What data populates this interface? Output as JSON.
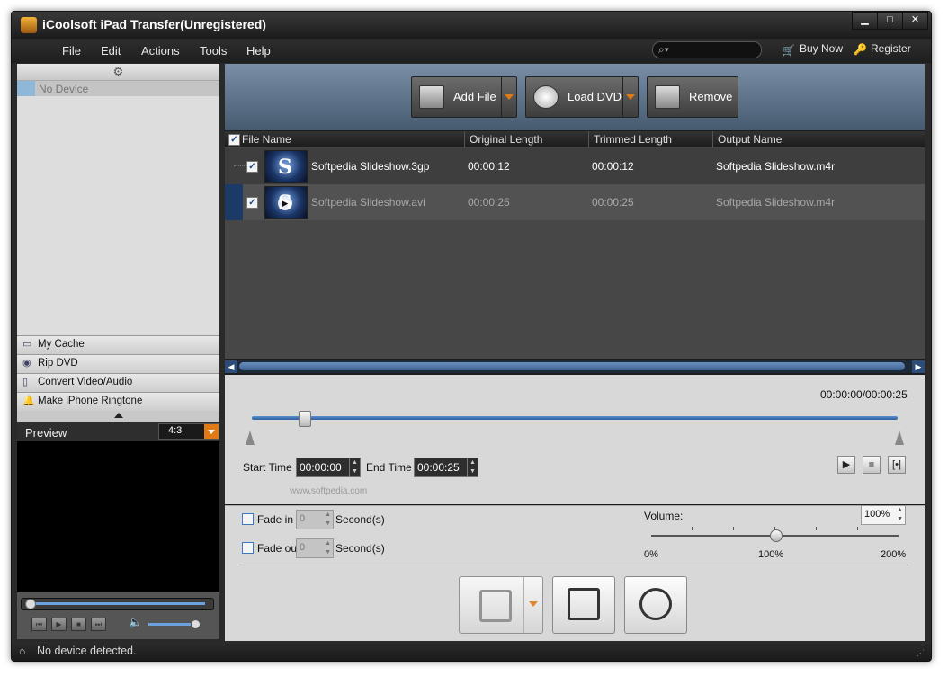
{
  "window": {
    "title": "iCoolsoft iPad Transfer(Unregistered)",
    "min": "▁",
    "max": "□",
    "close": "✕"
  },
  "menu": {
    "items": [
      "File",
      "Edit",
      "Actions",
      "Tools",
      "Help"
    ],
    "buy_now": "Buy Now",
    "register": "Register",
    "search_placeholder": ""
  },
  "sidebar": {
    "device": "No Device",
    "items": [
      {
        "label": "My Cache",
        "icon": "cache-icon"
      },
      {
        "label": "Rip DVD",
        "icon": "dvd-icon"
      },
      {
        "label": "Convert Video/Audio",
        "icon": "convert-icon"
      },
      {
        "label": "Make iPhone Ringtone",
        "icon": "bell-icon"
      }
    ],
    "preview_label": "Preview",
    "aspect": "4:3",
    "preview_progress": 0.0,
    "preview_volume": 0.9
  },
  "toolbar": {
    "add_file": "Add File",
    "load_dvd": "Load DVD",
    "remove": "Remove"
  },
  "table": {
    "headers": [
      "File Name",
      "Original Length",
      "Trimmed Length",
      "Output Name"
    ],
    "rows": [
      {
        "file": "Softpedia Slideshow.3gp",
        "original": "00:00:12",
        "trimmed": "00:00:12",
        "output": "Softpedia Slideshow.m4r",
        "checked": true,
        "selected": false
      },
      {
        "file": "Softpedia Slideshow.avi",
        "original": "00:00:25",
        "trimmed": "00:00:25",
        "output": "Softpedia Slideshow.m4r",
        "checked": true,
        "selected": true
      }
    ]
  },
  "trim": {
    "time_readout": "00:00:00/00:00:25",
    "start_label": "Start Time",
    "start_value": "00:00:00",
    "end_label": "End Time",
    "end_value": "00:00:25",
    "watermark": "www.softpedia.com"
  },
  "audio": {
    "fade_in_label": "Fade in",
    "fade_in_value": "0",
    "fade_out_label": "Fade out",
    "fade_out_value": "0",
    "seconds_label": "Second(s)",
    "volume_label": "Volume:",
    "volume_value": "100%",
    "volume_min": "0%",
    "volume_mid": "100%",
    "volume_max": "200%"
  },
  "status": {
    "text": "No device detected."
  },
  "colors": {
    "accent_orange": "#e07a16",
    "accent_blue": "#4a7fc0",
    "selected_row": "#525252"
  }
}
